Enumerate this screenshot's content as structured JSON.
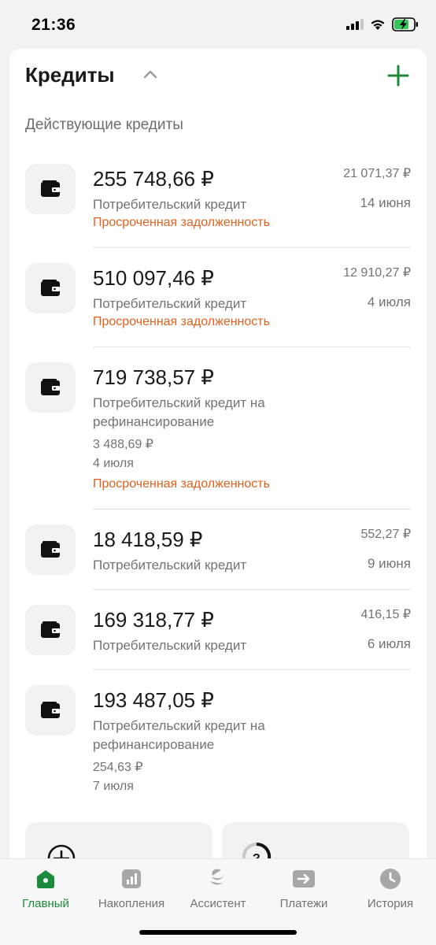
{
  "status": {
    "time": "21:36"
  },
  "section": {
    "title": "Кредиты",
    "subtitle": "Действующие кредиты"
  },
  "loans": [
    {
      "amount": "255 748,66 ₽",
      "type": "Потребительский кредит",
      "payment": "21 071,37 ₽",
      "date": "14 июня",
      "overdue": "Просроченная задолженность"
    },
    {
      "amount": "510 097,46 ₽",
      "type": "Потребительский кредит",
      "payment": "12 910,27 ₽",
      "date": "4 июля",
      "overdue": "Просроченная задолженность"
    },
    {
      "amount": "719 738,57 ₽",
      "type": "Потребительский кредит на рефинансирование",
      "payment": "3 488,69 ₽",
      "date": "4 июля",
      "overdue": "Просроченная задолженность"
    },
    {
      "amount": "18 418,59 ₽",
      "type": "Потребительский кредит",
      "payment": "552,27 ₽",
      "date": "9 июня"
    },
    {
      "amount": "169 318,77 ₽",
      "type": "Потребительский кредит",
      "payment": "416,15 ₽",
      "date": "6 июля"
    },
    {
      "amount": "193 487,05 ₽",
      "type": "Потребительский кредит на рефинансирование",
      "payment": "254,63 ₽",
      "date": "7 июля"
    }
  ],
  "tabs": [
    {
      "label": "Главный",
      "icon": "home-icon",
      "active": true
    },
    {
      "label": "Накопления",
      "icon": "chart-icon"
    },
    {
      "label": "Ассистент",
      "icon": "assistant-icon"
    },
    {
      "label": "Платежи",
      "icon": "transfer-icon"
    },
    {
      "label": "История",
      "icon": "clock-icon"
    }
  ],
  "colors": {
    "accent": "#1b8a3c",
    "overdue": "#e0621f",
    "muted": "#737373"
  }
}
